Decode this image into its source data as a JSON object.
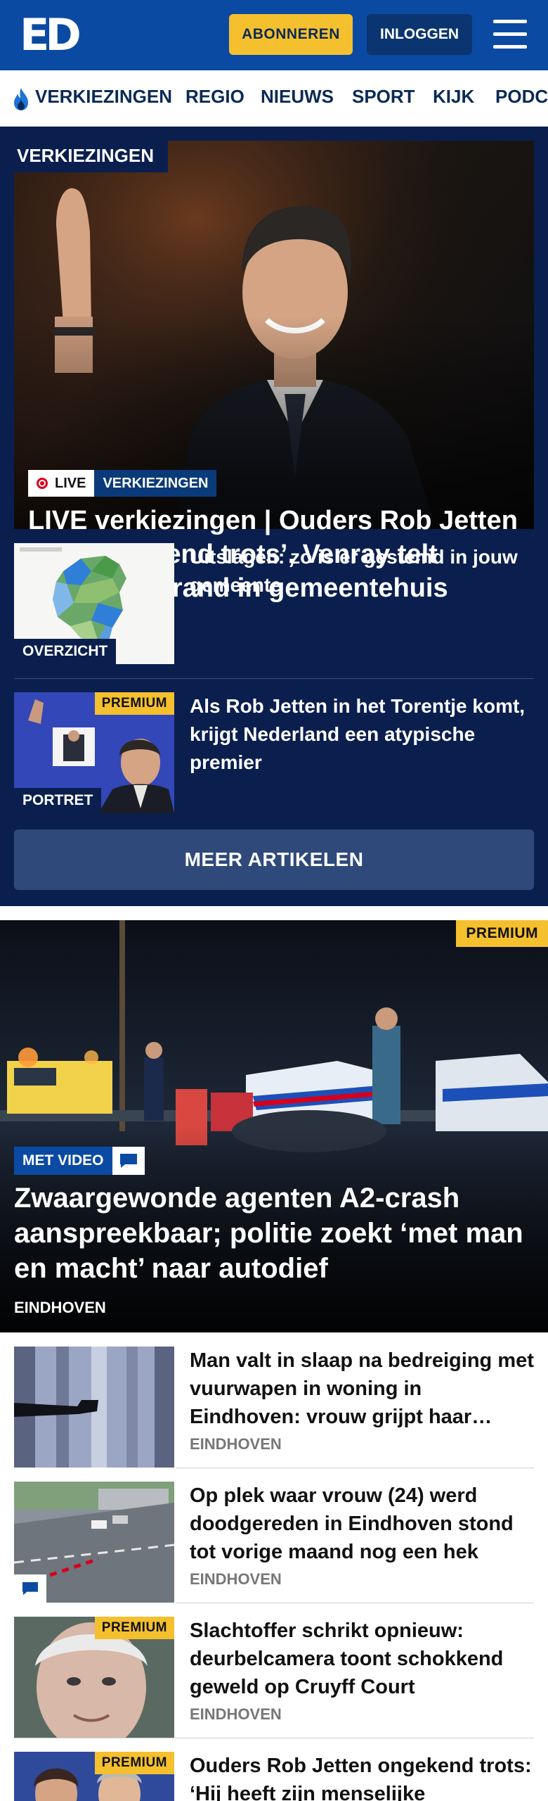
{
  "header": {
    "logo_text": "ED",
    "subscribe_label": "ABONNEREN",
    "login_label": "INLOGGEN"
  },
  "nav": {
    "items": [
      "VERKIEZINGEN",
      "REGIO",
      "NIEUWS",
      "SPORT",
      "KIJK",
      "PODC"
    ]
  },
  "elections": {
    "section_label": "VERKIEZINGEN",
    "hero": {
      "live_label": "LIVE",
      "category": "VERKIEZINGEN",
      "title": "LIVE verkiezingen | Ouders Rob Jetten zijn ‘ongekend trots’, Venray telt verder na brand in gemeente­huis"
    },
    "items": [
      {
        "label": "OVERZICHT",
        "title": "Uitslagen: zo is er gestemd in jouw gemeente"
      },
      {
        "label": "PORTRET",
        "premium": "PREMIUM",
        "title": "Als Rob Jetten in het Torentje komt, krijgt Nederland een atypische premier"
      }
    ],
    "more_label": "MEER ARTIKELEN"
  },
  "featured": {
    "premium": "PREMIUM",
    "video_label": "MET VIDEO",
    "title": "Zwaargewonde agenten A2-crash aanspreekbaar; politie zoekt ‘met man en macht’ naar autodief",
    "location": "EINDHOVEN"
  },
  "articles": [
    {
      "title": "Man valt in slaap na bedreiging met vuurwapen in woning in Eindhoven: vrouw grijpt haar…",
      "location": "EINDHOVEN"
    },
    {
      "title": "Op plek waar vrouw (24) werd doodgereden in Eindhoven stond tot vorige maand nog een hek",
      "location": "EINDHOVEN"
    },
    {
      "premium": "PREMIUM",
      "title": "Slachtoffer schrikt opnieuw: deurbelcamera toont schokkend geweld op Cruyff Court",
      "location": "EINDHOVEN"
    },
    {
      "premium": "PREMIUM",
      "title": "Ouders Rob Jetten ongekend trots: ‘Hij heeft zijn menselijke"
    }
  ],
  "colors": {
    "brand_blue": "#0b4aa2",
    "navy": "#0a1f4e",
    "subscribe_yellow": "#f5c02e"
  }
}
